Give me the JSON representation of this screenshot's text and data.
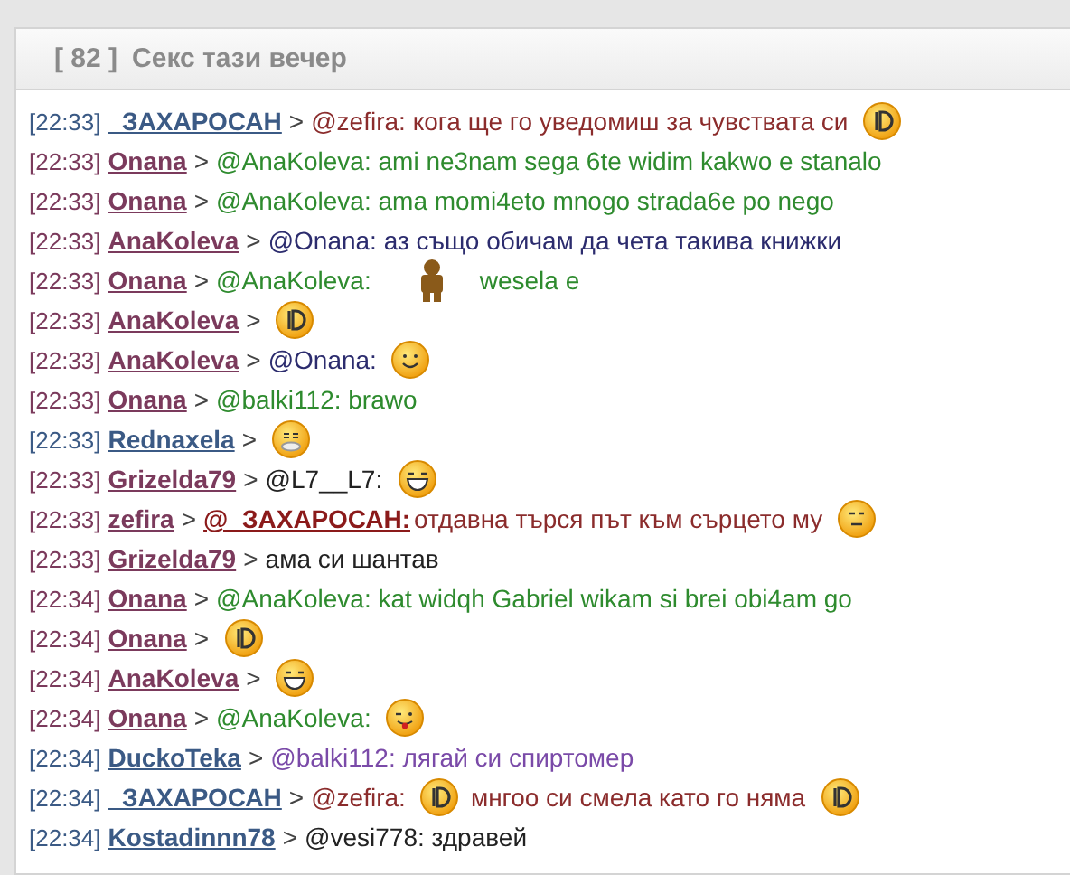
{
  "room": {
    "count": "[ 82 ]",
    "title": "Секс тази вечер"
  },
  "messages": [
    {
      "time": "[22:33]",
      "user": {
        "name": "_ЗАХАРОСАН",
        "color": "#3b5a85"
      },
      "separator": ">",
      "parts": [
        {
          "kind": "text",
          "text": "@zefira: кога ще го уведомиш за чувствата си",
          "color": "#8b2c2c"
        },
        {
          "kind": "smiley-d"
        }
      ]
    },
    {
      "time": "[22:33]",
      "user": {
        "name": "Onana",
        "color": "#7b3a5c"
      },
      "separator": ">",
      "parts": [
        {
          "kind": "text",
          "text": "@AnaKoleva: ami ne3nam sega 6te widim kakwo e stanalo",
          "color": "#2e8b2e"
        }
      ]
    },
    {
      "time": "[22:33]",
      "user": {
        "name": "Onana",
        "color": "#7b3a5c"
      },
      "separator": ">",
      "parts": [
        {
          "kind": "text",
          "text": "@AnaKoleva: ama momi4eto mnogo strada6e po nego",
          "color": "#2e8b2e"
        }
      ]
    },
    {
      "time": "[22:33]",
      "user": {
        "name": "AnaKoleva",
        "color": "#7b3a5c"
      },
      "separator": ">",
      "parts": [
        {
          "kind": "text",
          "text": "@Onana: аз също обичам да чета такива книжки",
          "color": "#2c2c6e"
        }
      ]
    },
    {
      "time": "[22:33]",
      "user": {
        "name": "Onana",
        "color": "#7b3a5c"
      },
      "separator": ">",
      "parts": [
        {
          "kind": "text",
          "text": "@AnaKoleva:",
          "color": "#2e8b2e"
        },
        {
          "kind": "figure"
        },
        {
          "kind": "text",
          "text": "wesela e",
          "color": "#2e8b2e"
        }
      ]
    },
    {
      "time": "[22:33]",
      "user": {
        "name": "AnaKoleva",
        "color": "#7b3a5c"
      },
      "separator": ">",
      "parts": [
        {
          "kind": "smiley-d"
        }
      ]
    },
    {
      "time": "[22:33]",
      "user": {
        "name": "AnaKoleva",
        "color": "#7b3a5c"
      },
      "separator": ">",
      "parts": [
        {
          "kind": "text",
          "text": "@Onana:",
          "color": "#2c2c6e"
        },
        {
          "kind": "smiley-smile"
        }
      ]
    },
    {
      "time": "[22:33]",
      "user": {
        "name": "Onana",
        "color": "#7b3a5c"
      },
      "separator": ">",
      "parts": [
        {
          "kind": "text",
          "text": "@balki112: brawo",
          "color": "#2e8b2e"
        }
      ]
    },
    {
      "time": "[22:33]",
      "user": {
        "name": "Rednaxela",
        "color": "#3b5a85"
      },
      "separator": ">",
      "parts": [
        {
          "kind": "smiley-sick"
        }
      ]
    },
    {
      "time": "[22:33]",
      "user": {
        "name": "Grizelda79",
        "color": "#7b3a5c"
      },
      "separator": ">",
      "parts": [
        {
          "kind": "text",
          "text": "@L7__L7:",
          "color": "#222222"
        },
        {
          "kind": "smiley-grin"
        }
      ]
    },
    {
      "time": "[22:33]",
      "user": {
        "name": "zefira",
        "color": "#7b3a5c"
      },
      "separator": ">",
      "parts": [
        {
          "kind": "mention",
          "text": "@_ЗАХАРОСАН:",
          "color": "#8b1a1a"
        },
        {
          "kind": "text",
          "text": "отдавна търся път към сърцето му",
          "color": "#8b2c2c"
        },
        {
          "kind": "smiley-neutral"
        }
      ]
    },
    {
      "time": "[22:33]",
      "user": {
        "name": "Grizelda79",
        "color": "#7b3a5c"
      },
      "separator": ">",
      "parts": [
        {
          "kind": "text",
          "text": "ама си шантав",
          "color": "#222222"
        }
      ]
    },
    {
      "time": "[22:34]",
      "user": {
        "name": "Onana",
        "color": "#7b3a5c"
      },
      "separator": ">",
      "parts": [
        {
          "kind": "text",
          "text": "@AnaKoleva: kat widqh Gabriel wikam si brei obi4am go",
          "color": "#2e8b2e"
        }
      ]
    },
    {
      "time": "[22:34]",
      "user": {
        "name": "Onana",
        "color": "#7b3a5c"
      },
      "separator": ">",
      "parts": [
        {
          "kind": "smiley-d"
        }
      ]
    },
    {
      "time": "[22:34]",
      "user": {
        "name": "AnaKoleva",
        "color": "#7b3a5c"
      },
      "separator": ">",
      "parts": [
        {
          "kind": "smiley-grin"
        }
      ]
    },
    {
      "time": "[22:34]",
      "user": {
        "name": "Onana",
        "color": "#7b3a5c"
      },
      "separator": ">",
      "parts": [
        {
          "kind": "text",
          "text": "@AnaKoleva:",
          "color": "#2e8b2e"
        },
        {
          "kind": "smiley-tongue"
        }
      ]
    },
    {
      "time": "[22:34]",
      "user": {
        "name": "DuckoTeka",
        "color": "#3b5a85"
      },
      "separator": ">",
      "parts": [
        {
          "kind": "text",
          "text": "@balki112:  лягай си спиртомер",
          "color": "#7a4aa8"
        }
      ]
    },
    {
      "time": "[22:34]",
      "user": {
        "name": "_ЗАХАРОСАН",
        "color": "#3b5a85"
      },
      "separator": ">",
      "parts": [
        {
          "kind": "text",
          "text": "@zefira:",
          "color": "#8b2c2c"
        },
        {
          "kind": "smiley-d"
        },
        {
          "kind": "text",
          "text": "мнгоо си смела като го няма",
          "color": "#8b2c2c"
        },
        {
          "kind": "smiley-d"
        }
      ]
    },
    {
      "time": "[22:34]",
      "user": {
        "name": "Kostadinnn78",
        "color": "#3b5a85"
      },
      "separator": ">",
      "parts": [
        {
          "kind": "text",
          "text": "@vesi778: здравей",
          "color": "#222222"
        }
      ]
    }
  ]
}
